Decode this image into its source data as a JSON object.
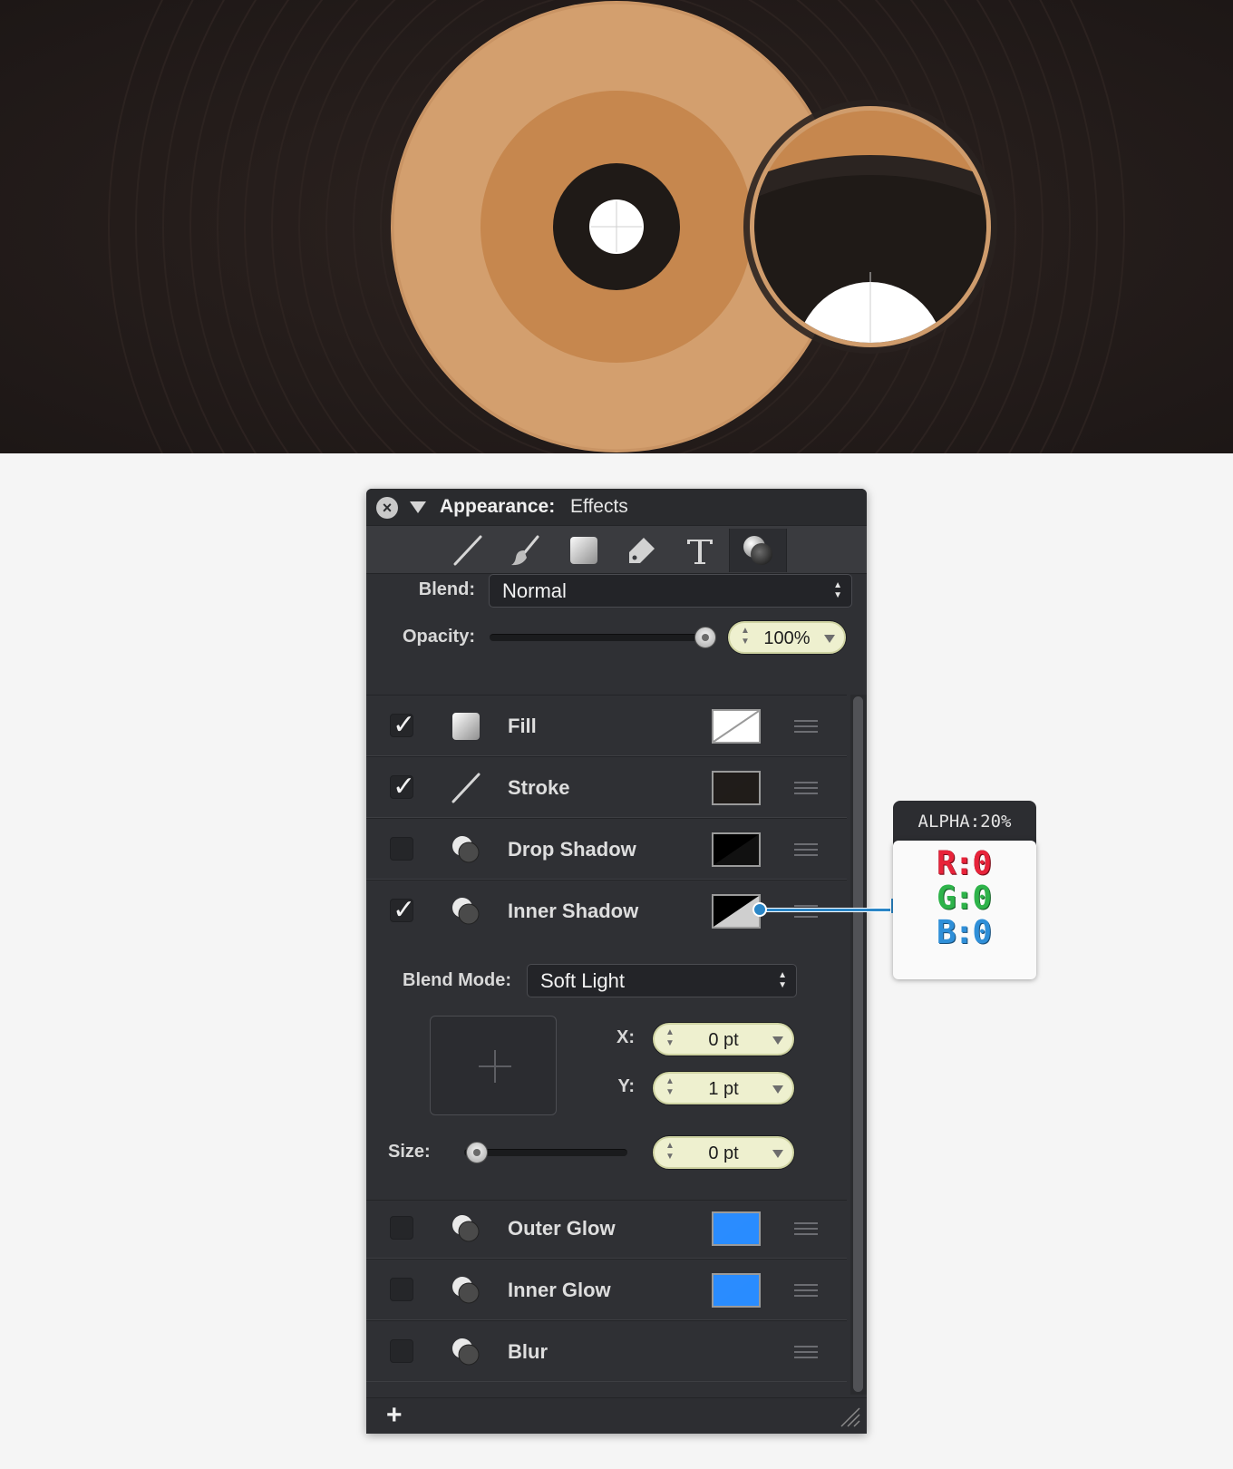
{
  "panel": {
    "title_label": "Appearance:",
    "title_value": "Effects",
    "tools": [
      "line-tool-icon",
      "brush-tool-icon",
      "fill-tool-icon",
      "tag-tool-icon",
      "text-tool-icon",
      "effects-tool-icon"
    ],
    "active_tool": "effects-tool-icon",
    "blend_label": "Blend:",
    "blend_value": "Normal",
    "opacity_label": "Opacity:",
    "opacity_value": "100%",
    "opacity_level": 1.0
  },
  "effects": [
    {
      "label": "Fill",
      "checked": true,
      "icon": "fill-icon",
      "swatch": "none-swatch"
    },
    {
      "label": "Stroke",
      "checked": true,
      "icon": "stroke-icon",
      "swatch": "#201c1a"
    },
    {
      "label": "Drop Shadow",
      "checked": false,
      "icon": "effect-icon",
      "swatch": "black-split"
    },
    {
      "label": "Inner Shadow",
      "checked": true,
      "icon": "effect-icon",
      "swatch": "black-split-light"
    },
    {
      "label": "Outer Glow",
      "checked": false,
      "icon": "effect-icon",
      "swatch": "#2a8cff"
    },
    {
      "label": "Inner Glow",
      "checked": false,
      "icon": "effect-icon",
      "swatch": "#2a8cff"
    },
    {
      "label": "Blur",
      "checked": false,
      "icon": "effect-icon",
      "swatch": ""
    }
  ],
  "inner_shadow": {
    "blend_mode_label": "Blend Mode:",
    "blend_mode_value": "Soft Light",
    "x_label": "X:",
    "x_value": "0 pt",
    "y_label": "Y:",
    "y_value": "1 pt",
    "size_label": "Size:",
    "size_value": "0 pt",
    "size_level": 0
  },
  "footer": {
    "add_label": "+"
  },
  "callout": {
    "header": "ALPHA:20%",
    "r": "R:0",
    "g": "G:0",
    "b": "B:0"
  },
  "colors": {
    "canvas_bg": "#221a18",
    "outer_circle": "#d39f6e",
    "mid_circle": "#c6874e",
    "dark_ring": "#1f1a17",
    "accent_blue": "#2a8cff"
  }
}
